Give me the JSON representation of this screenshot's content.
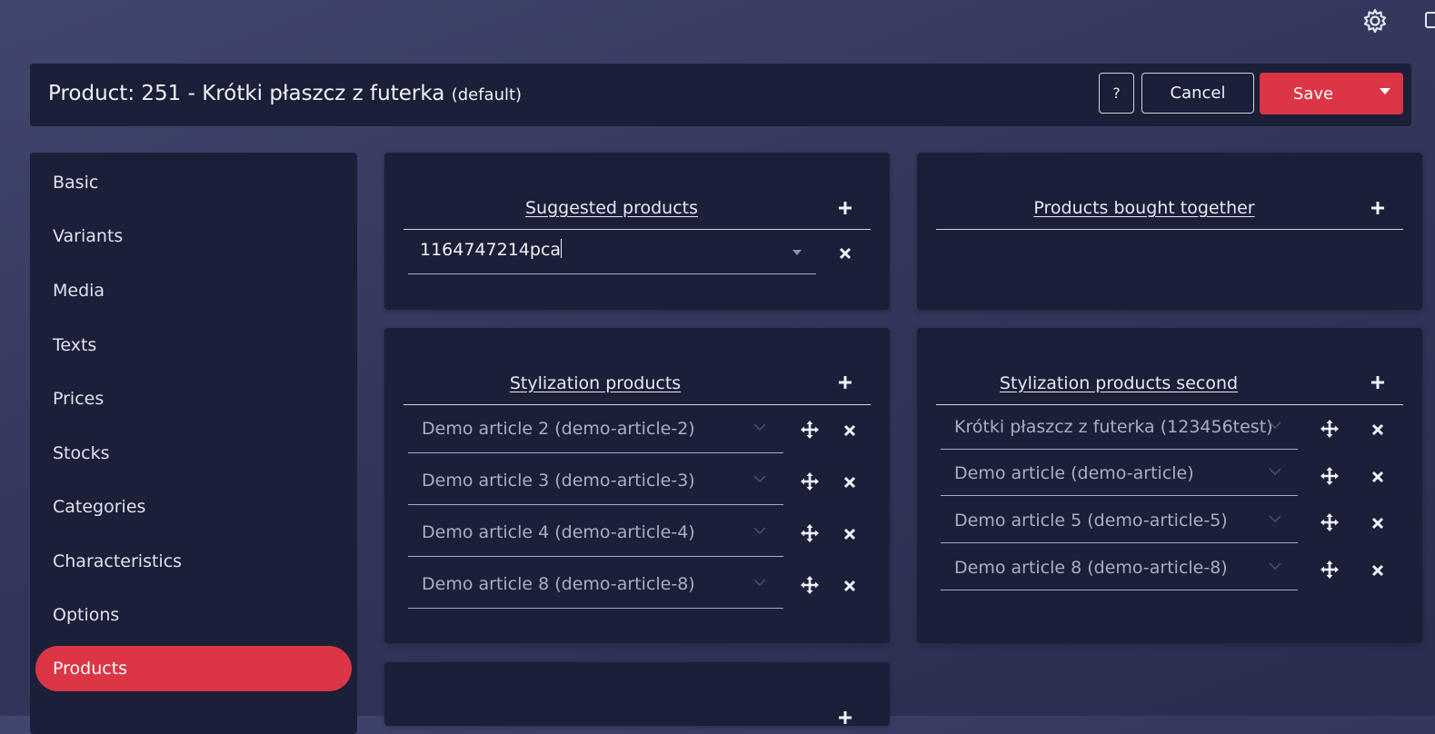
{
  "topbar": {
    "settings_icon": "gear-icon",
    "edge_icon": "window-icon"
  },
  "header": {
    "title": "Product: 251 - Krótki płaszcz z futerka",
    "title_suffix": "(default)",
    "help_label": "?",
    "cancel_label": "Cancel",
    "save_label": "Save",
    "save_dropdown_icon": "caret-down-icon"
  },
  "sidebar": {
    "items": [
      {
        "label": "Basic",
        "active": false
      },
      {
        "label": "Variants",
        "active": false
      },
      {
        "label": "Media",
        "active": false
      },
      {
        "label": "Texts",
        "active": false
      },
      {
        "label": "Prices",
        "active": false
      },
      {
        "label": "Stocks",
        "active": false
      },
      {
        "label": "Categories",
        "active": false
      },
      {
        "label": "Characteristics",
        "active": false
      },
      {
        "label": "Options",
        "active": false
      },
      {
        "label": "Products",
        "active": true
      }
    ]
  },
  "sections": {
    "suggested": {
      "title": "Suggested products",
      "search_value": "1164747214pca"
    },
    "bought_together": {
      "title": "Products bought together"
    },
    "stylization": {
      "title": "Stylization products",
      "items": [
        "Demo article 2 (demo-article-2)",
        "Demo article 3 (demo-article-3)",
        "Demo article 4 (demo-article-4)",
        "Demo article 8 (demo-article-8)"
      ]
    },
    "stylization_second": {
      "title": "Stylization products second",
      "items": [
        "Krótki płaszcz z futerka (123456test)",
        "Demo article (demo-article)",
        "Demo article 5 (demo-article-5)",
        "Demo article 8 (demo-article-8)"
      ]
    }
  },
  "colors": {
    "accent": "#dc3545",
    "panel": "#1b1f38",
    "background": "#3a3e65"
  }
}
